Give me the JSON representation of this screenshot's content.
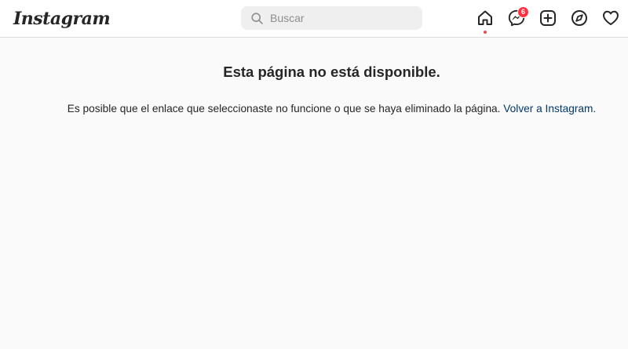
{
  "header": {
    "logo_text": "Instagram",
    "search": {
      "placeholder": "Buscar",
      "icon": "search-icon"
    },
    "nav": [
      {
        "name": "home",
        "icon": "home-icon",
        "active": true
      },
      {
        "name": "direct",
        "icon": "messenger-icon",
        "badge": "6"
      },
      {
        "name": "new-post",
        "icon": "plus-square-icon"
      },
      {
        "name": "explore",
        "icon": "compass-icon"
      },
      {
        "name": "activity",
        "icon": "heart-icon"
      }
    ],
    "colors": {
      "badge": "#ff3040",
      "active_dot": "#ed4956",
      "link": "#00376b"
    }
  },
  "main": {
    "title": "Esta página no está disponible.",
    "message": "Es posible que el enlace que seleccionaste no funcione o que se haya eliminado la página.",
    "link_label": "Volver a Instagram."
  }
}
